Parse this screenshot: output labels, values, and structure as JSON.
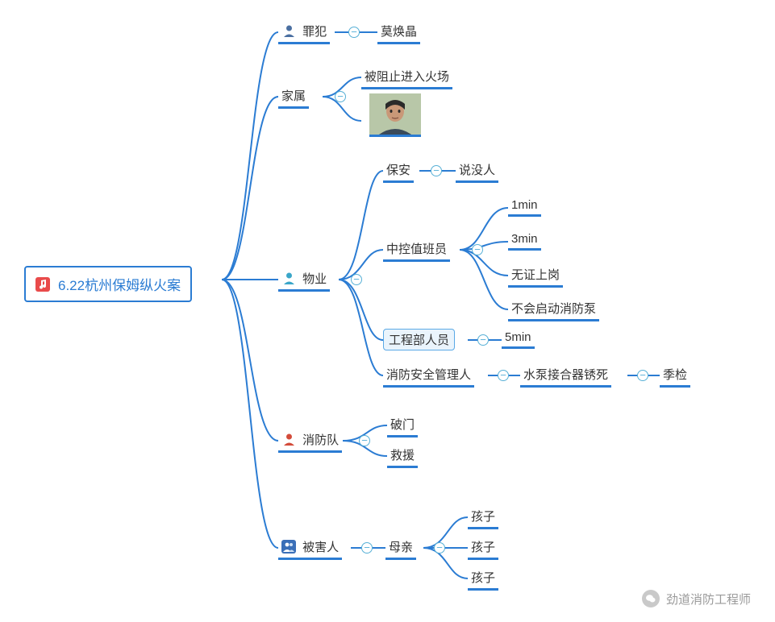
{
  "root": {
    "label": "6.22杭州保姆纵火案"
  },
  "branches": {
    "criminal": {
      "label": "罪犯",
      "child": "莫焕晶",
      "icon": "person-blue"
    },
    "family": {
      "label": "家属",
      "child": "被阻止进入火场"
    },
    "property": {
      "label": "物业",
      "icon": "person-cyan",
      "security": {
        "label": "保安",
        "child": "说没人"
      },
      "controller": {
        "label": "中控值班员",
        "items": [
          "1min",
          "3min",
          "无证上岗",
          "不会启动消防泵"
        ]
      },
      "engineer": {
        "label": "工程部人员",
        "child": "5min"
      },
      "safetymgr": {
        "label": "消防安全管理人",
        "child": "水泵接合器锈死",
        "grand": "季检"
      }
    },
    "firedept": {
      "label": "消防队",
      "icon": "person-red",
      "items": [
        "破门",
        "救援"
      ]
    },
    "victims": {
      "label": "被害人",
      "icon": "persons-blue",
      "mother": "母亲",
      "items": [
        "孩子",
        "孩子",
        "孩子"
      ]
    }
  },
  "watermark": "劲道消防工程师"
}
